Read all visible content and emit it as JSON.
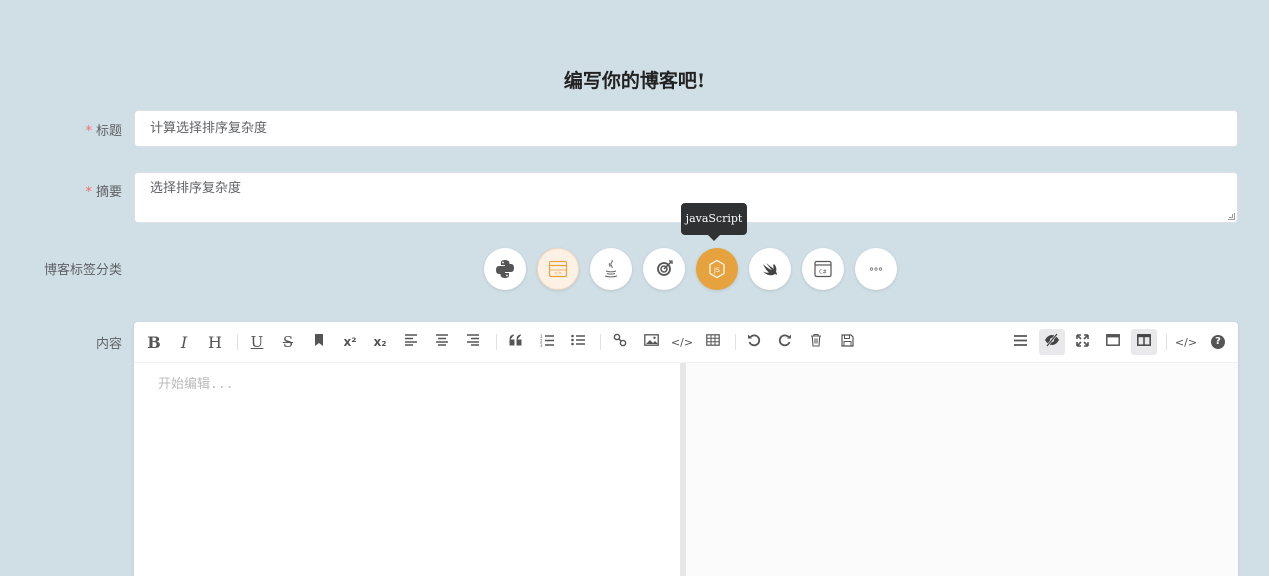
{
  "page": {
    "title": "编写你的博客吧!"
  },
  "form": {
    "required_mark": "*",
    "title_label": "标题",
    "title_value": "计算选择排序复杂度",
    "summary_label": "摘要",
    "summary_value": "选择排序复杂度",
    "tags_label": "博客标签分类",
    "content_label": "内容"
  },
  "tags": {
    "items": [
      "python-icon",
      "html-icon",
      "java-icon",
      "target-icon",
      "javascript-icon",
      "swift-icon",
      "csharp-icon",
      "more-icon"
    ],
    "active": "javascript-icon",
    "tooltip": "javaScript",
    "colors": {
      "active": "#e6a23c",
      "light": "#fdf1e6"
    }
  },
  "editor": {
    "placeholder": "开始编辑...",
    "toolbar_left": [
      "bold",
      "italic",
      "header",
      "underline",
      "strikethrough",
      "mark",
      "superscript",
      "subscript",
      "align-left",
      "align-center",
      "align-right",
      "quote",
      "ordered-list",
      "unordered-list",
      "link",
      "image",
      "code",
      "table",
      "undo",
      "redo",
      "trash",
      "save"
    ],
    "toolbar_right": [
      "navigation",
      "preview-toggle",
      "fullscreen",
      "read-mode",
      "subfield",
      "html-code",
      "help"
    ],
    "bold_glyph": "B",
    "italic_glyph": "I",
    "header_glyph": "H",
    "underline_glyph": "U",
    "strike_glyph": "S",
    "sup_glyph": "x²",
    "sub_glyph": "x₂",
    "code_glyph": "</>",
    "help_glyph": "?"
  }
}
